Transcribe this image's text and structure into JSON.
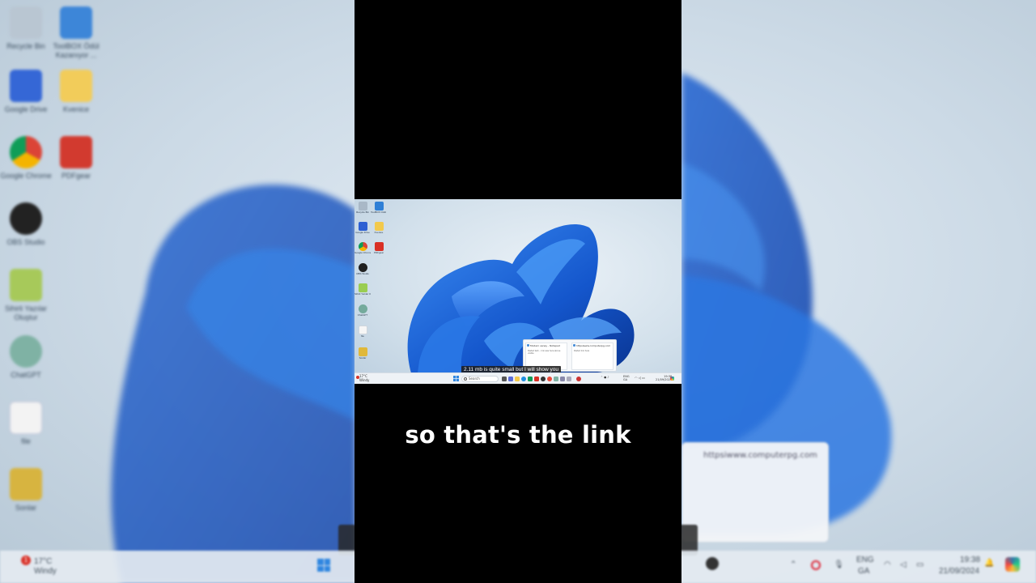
{
  "background": {
    "icons": [
      {
        "label": "Recycle Bin",
        "icon": "recycle-bin-icon"
      },
      {
        "label": "ToolBOX Ödül Kazanıyor ...",
        "icon": "toolbox-icon"
      },
      {
        "label": "Google Drive",
        "icon": "google-drive-icon"
      },
      {
        "label": "Kvenice",
        "icon": "folder-icon"
      },
      {
        "label": "Google Chrome",
        "icon": "chrome-icon"
      },
      {
        "label": "PDFgear",
        "icon": "pdf-icon"
      },
      {
        "label": "OBS Studio",
        "icon": "obs-icon"
      },
      {
        "label": "Sihirli Yazılar Oluştur",
        "icon": "app-shortcut-icon"
      },
      {
        "label": "ChatGPT",
        "icon": "chatgpt-icon"
      },
      {
        "label": "file",
        "icon": "file-icon"
      },
      {
        "label": "Sonlar",
        "icon": "shortcut-icon"
      }
    ],
    "weather_temp": "17°C",
    "weather_desc": "Windy",
    "lang": "ENG",
    "lang_region": "GA",
    "clock_time": "19:38",
    "clock_date": "21/09/2024",
    "notification_count": "1",
    "popup_title": "httpsiwww.computerpg.com"
  },
  "screen": {
    "desktop_icons": [
      {
        "label": "Recycle Bin",
        "icon": "recycle-bin-icon",
        "color": "#8fa3b5"
      },
      {
        "label": "ToolBOX Ödül Kazanıyor",
        "icon": "toolbox-icon",
        "color": "#2f7fd6"
      },
      {
        "label": "Google Drive",
        "icon": "google-drive-icon",
        "color": "#2c5fd3"
      },
      {
        "label": "Kvenice",
        "icon": "folder-icon",
        "color": "#f2c94c"
      },
      {
        "label": "Google Chrome",
        "icon": "chrome-icon",
        "color": "#34a853"
      },
      {
        "label": "PDFgear",
        "icon": "pdf-icon",
        "color": "#d93025"
      },
      {
        "label": "OBS Studio",
        "icon": "obs-icon",
        "color": "#202020"
      },
      {
        "label": "Sihirli Yazılar Oluştur",
        "icon": "app-shortcut-icon",
        "color": "#9acd52"
      },
      {
        "label": "ChatGPT",
        "icon": "chatgpt-icon",
        "color": "#74aa9c"
      },
      {
        "label": "file",
        "icon": "file-icon",
        "color": "#f1f1f1"
      },
      {
        "label": "Sonlar",
        "icon": "shortcut-icon",
        "color": "#e0b83a"
      }
    ],
    "taskbar": {
      "weather_temp": "17°C",
      "weather_desc": "Windy",
      "search_placeholder": "Search",
      "lang": "ENG",
      "lang_region": "GA",
      "clock_time": "19:38",
      "clock_date": "21/09/2024"
    },
    "popup": {
      "left_title": "Modern sanay - Notepad",
      "left_body": "Pasted text... link was here above visible",
      "right_title": "httpsiwww.computerpg.com",
      "right_body": "Pasted link here"
    },
    "caption": "2.11 mb is quite small but I will show you"
  },
  "subtitle": "so that's the link",
  "colors": {
    "accent": "#1a73e8",
    "bloom": "#1f6fe0",
    "background": "#000000"
  }
}
